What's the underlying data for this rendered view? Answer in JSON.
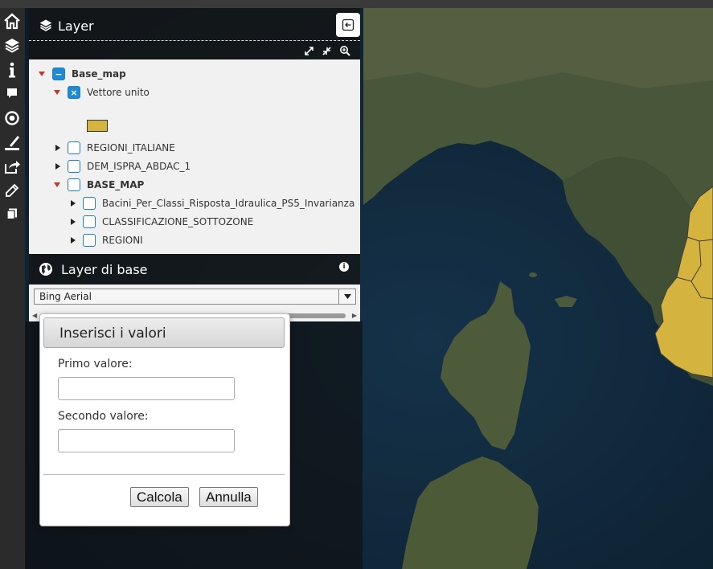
{
  "toolbar": {
    "items": [
      "home-icon",
      "layers-icon",
      "info-icon",
      "comment-icon",
      "target-icon",
      "ruler-icon",
      "share-icon",
      "pencil-icon",
      "copy-icon"
    ]
  },
  "layer_panel": {
    "title": "Layer",
    "tree": [
      {
        "label": "Base_map",
        "bold": true,
        "expanded": true,
        "state": "partial"
      },
      {
        "label": "Vettore unito",
        "bold": false,
        "expanded": true,
        "state": "checked"
      },
      {
        "label": "REGIONI_ITALIANE",
        "bold": false,
        "expanded": false,
        "state": "unchecked"
      },
      {
        "label": "DEM_ISPRA_ABDAC_1",
        "bold": false,
        "expanded": false,
        "state": "unchecked"
      },
      {
        "label": "BASE_MAP",
        "bold": true,
        "expanded": true,
        "state": "unchecked"
      },
      {
        "label": "Bacini_Per_Classi_Risposta_Idraulica_PS5_Invarianza",
        "bold": false,
        "expanded": false,
        "state": "unchecked"
      },
      {
        "label": "CLASSIFICAZIONE_SOTTOZONE",
        "bold": false,
        "expanded": false,
        "state": "unchecked"
      },
      {
        "label": "REGIONI",
        "bold": false,
        "expanded": false,
        "state": "unchecked"
      }
    ],
    "legend_color": "#d4b43e"
  },
  "base_layer": {
    "title": "Layer di base",
    "selected": "Bing Aerial"
  },
  "dialog": {
    "title": "Inserisci i valori",
    "first_label": "Primo valore:",
    "first_value": "",
    "second_label": "Secondo valore:",
    "second_value": "",
    "calc_button": "Calcola",
    "cancel_button": "Annulla"
  },
  "colors": {
    "sea": "#0e2433",
    "land": "#44533a",
    "highlight_region": "#d4b43e",
    "accent": "#1d8ad3"
  }
}
